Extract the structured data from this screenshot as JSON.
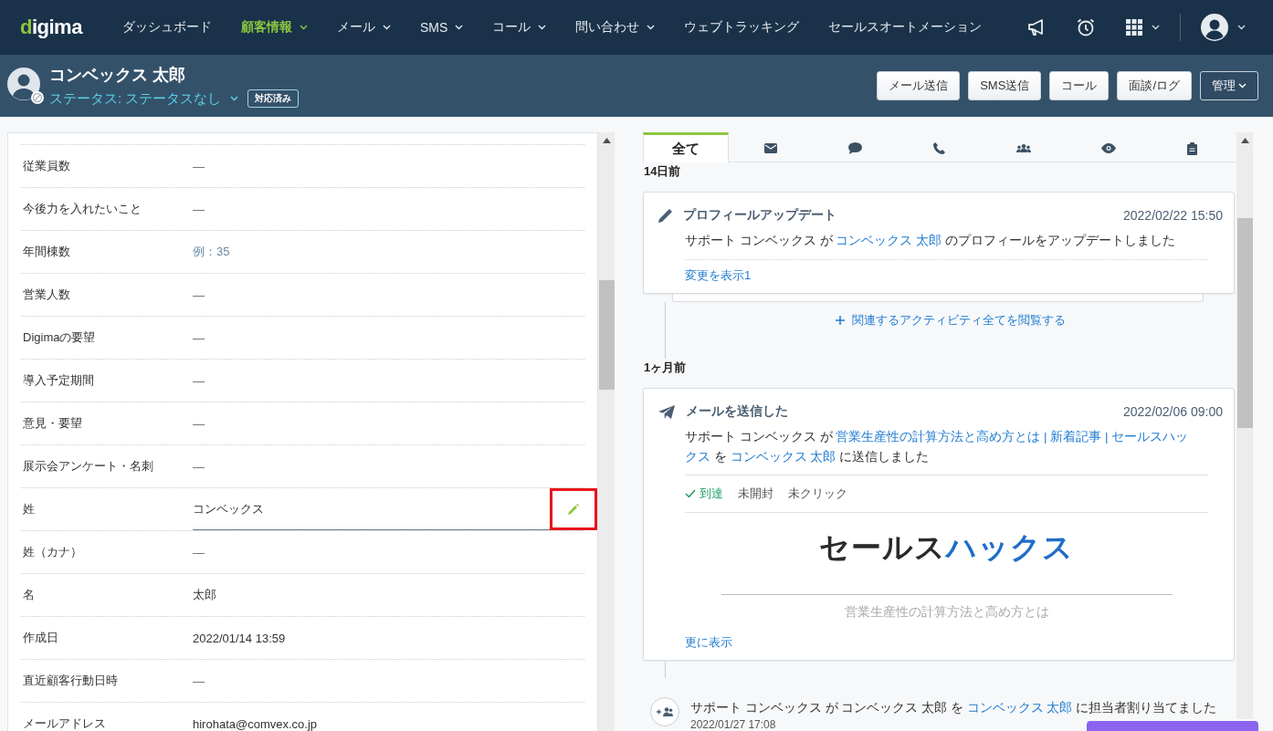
{
  "nav": {
    "logo": "digima",
    "items": [
      {
        "label": "ダッシュボード",
        "selected": false,
        "dropdown": false
      },
      {
        "label": "顧客情報",
        "selected": true,
        "dropdown": true
      },
      {
        "label": "メール",
        "selected": false,
        "dropdown": true
      },
      {
        "label": "SMS",
        "selected": false,
        "dropdown": true
      },
      {
        "label": "コール",
        "selected": false,
        "dropdown": true
      },
      {
        "label": "問い合わせ",
        "selected": false,
        "dropdown": true
      },
      {
        "label": "ウェブトラッキング",
        "selected": false,
        "dropdown": false
      },
      {
        "label": "セールスオートメーション",
        "selected": false,
        "dropdown": false
      }
    ]
  },
  "contact": {
    "name": "コンベックス 太郎",
    "status": "ステータス: ステータスなし",
    "badge": "対応済み"
  },
  "actions": [
    {
      "label": "メール送信",
      "kind": "plain"
    },
    {
      "label": "SMS送信",
      "kind": "plain"
    },
    {
      "label": "コール",
      "kind": "plain"
    },
    {
      "label": "面談/ログ",
      "kind": "plain"
    },
    {
      "label": "管理",
      "kind": "menu"
    }
  ],
  "fields": [
    {
      "label": "従業員数",
      "value": "―",
      "kind": "empty",
      "highlighted": false
    },
    {
      "label": "今後力を入れたいこと",
      "value": "―",
      "kind": "empty",
      "highlighted": false
    },
    {
      "label": "年間棟数",
      "value": "例：35",
      "kind": "placeholder",
      "highlighted": false
    },
    {
      "label": "営業人数",
      "value": "―",
      "kind": "empty",
      "highlighted": false
    },
    {
      "label": "Digimaの要望",
      "value": "―",
      "kind": "empty",
      "highlighted": false
    },
    {
      "label": "導入予定期間",
      "value": "―",
      "kind": "empty",
      "highlighted": false
    },
    {
      "label": "意見・要望",
      "value": "―",
      "kind": "empty",
      "highlighted": false
    },
    {
      "label": "展示会アンケート・名刺",
      "value": "―",
      "kind": "empty",
      "highlighted": false
    },
    {
      "label": "姓",
      "value": "コンベックス",
      "kind": "editing",
      "highlighted": true
    },
    {
      "label": "姓（カナ）",
      "value": "―",
      "kind": "empty",
      "highlighted": false
    },
    {
      "label": "名",
      "value": "太郎",
      "kind": "text",
      "highlighted": false
    },
    {
      "label": "作成日",
      "value": "2022/01/14 13:59",
      "kind": "text",
      "highlighted": false
    },
    {
      "label": "直近顧客行動日時",
      "value": "―",
      "kind": "empty",
      "highlighted": false
    },
    {
      "label": "メールアドレス",
      "value": "hirohata@comvex.co.jp",
      "kind": "text",
      "highlighted": false
    }
  ],
  "tabs": [
    {
      "kind": "all",
      "label": "全て",
      "selected": true
    },
    {
      "kind": "mail",
      "selected": false
    },
    {
      "kind": "chat",
      "selected": false
    },
    {
      "kind": "phone",
      "selected": false
    },
    {
      "kind": "group",
      "selected": false
    },
    {
      "kind": "view",
      "selected": false
    },
    {
      "kind": "clipboard",
      "selected": false
    }
  ],
  "timeline": [
    {
      "heading": "14日前",
      "card": {
        "kind": "profile_update",
        "title": "プロフィールアップデート",
        "date": "2022/02/22 15:50",
        "lines": [
          [
            {
              "text": "サポート コンベックス が ",
              "link": false
            },
            {
              "text": "コンベックス 太郎",
              "link": true
            },
            {
              "text": " のプロフィールをアップデートしました",
              "link": false
            }
          ]
        ],
        "link": "変更を表示1"
      },
      "more_link": "関連するアクティビティ全てを閲覧する"
    },
    {
      "heading": "1ヶ月前",
      "card": {
        "kind": "email",
        "title": "メールを送信した",
        "date": "2022/02/06 09:00",
        "lines": [
          [
            {
              "text": "サポート コンベックス が ",
              "link": false
            },
            {
              "text": "営業生産性の計算方法と高め方とは | 新着記事 | セールスハッ",
              "link": true
            }
          ],
          [
            {
              "text": "クス",
              "link": true
            },
            {
              "text": " を ",
              "link": false
            },
            {
              "text": "コンベックス 太郎",
              "link": true
            },
            {
              "text": " に送信しました",
              "link": false
            }
          ]
        ],
        "statuses": [
          {
            "label": "到達",
            "reached": true
          },
          {
            "label": "未開封",
            "reached": false
          },
          {
            "label": "未クリック",
            "reached": false
          }
        ],
        "preview": {
          "logo_dark": "セールス",
          "logo_accent": "ハックス",
          "heading": "営業生産性の計算方法と高め方とは"
        },
        "link": "更に表示"
      }
    }
  ],
  "assignment": {
    "lines": [
      [
        {
          "text": "サポート コンベックス が コンベックス 太郎 を ",
          "link": false
        },
        {
          "text": "コンベックス 太郎",
          "link": true
        },
        {
          "text": " に担当者割り当てました",
          "link": false
        }
      ]
    ],
    "date": "2022/01/27 17:08"
  }
}
